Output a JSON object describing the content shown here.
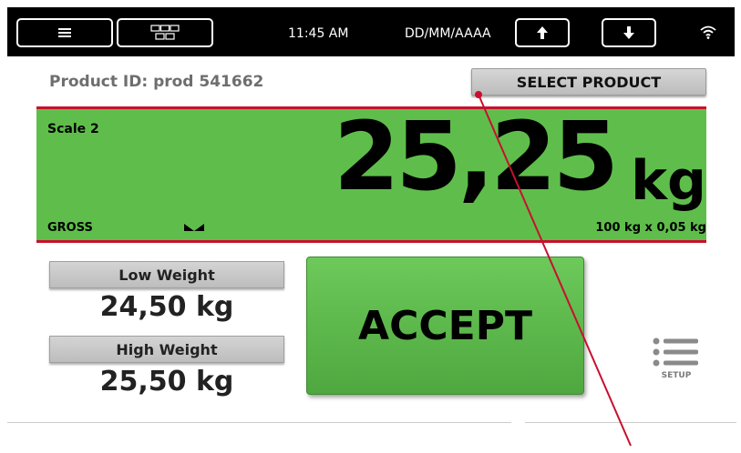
{
  "topbar": {
    "menu_icon": "hamburger-icon",
    "keypad_icon": "keypad-grid-icon",
    "time": "11:45 AM",
    "date": "DD/MM/AAAA",
    "up_icon": "arrow-up-icon",
    "down_icon": "arrow-down-icon",
    "wifi_icon": "wifi-icon"
  },
  "product": {
    "id_label": "Product ID: prod 541662",
    "select_label": "SELECT PRODUCT"
  },
  "scale": {
    "name": "Scale 2",
    "weight": "25,25",
    "unit": "kg",
    "mode": "GROSS",
    "stable_icon": "stability-indicator-icon",
    "capacity": "100 kg x 0,05 kg",
    "background_color": "#5fbe4b",
    "border_color": "#c8102e"
  },
  "limits": {
    "low_label": "Low Weight",
    "low_value": "24,50 kg",
    "high_label": "High Weight",
    "high_value": "25,50 kg"
  },
  "actions": {
    "accept_label": "ACCEPT",
    "accept_color": "#5cb84a",
    "setup_label": "SETUP",
    "setup_icon": "list-menu-icon"
  },
  "annotation": {
    "pointer_color": "#c8102e"
  }
}
